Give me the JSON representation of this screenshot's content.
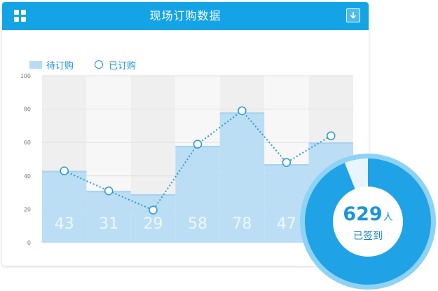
{
  "header": {
    "title": "现场订购数据",
    "menu_icon": "grid-icon",
    "download_icon": "download-icon"
  },
  "legend": {
    "bar_label": "待订购",
    "line_label": "已订购"
  },
  "colors": {
    "accent": "#14a4e6",
    "bar": "#b7dcf3",
    "line": "#2b9ad6",
    "badge_ring": "#8ed2f5",
    "badge_fill": "#1fa3e6"
  },
  "chart_data": {
    "type": "bar",
    "ylim": [
      0,
      100
    ],
    "yticks": [
      0,
      20,
      40,
      60,
      80,
      100
    ],
    "grid": true,
    "legend_position": "top-left",
    "series": [
      {
        "name": "待订购",
        "type": "bar",
        "values": [
          43,
          31,
          29,
          58,
          78,
          47,
          60
        ]
      },
      {
        "name": "已订购",
        "type": "line",
        "values": [
          43,
          31,
          19.5,
          59,
          79,
          48,
          64
        ]
      }
    ],
    "value_labels": [
      "43",
      "31",
      "29",
      "58",
      "78",
      "47",
      ""
    ]
  },
  "badge": {
    "count": "629",
    "unit": "人",
    "label": "已签到",
    "progress": 0.94
  }
}
